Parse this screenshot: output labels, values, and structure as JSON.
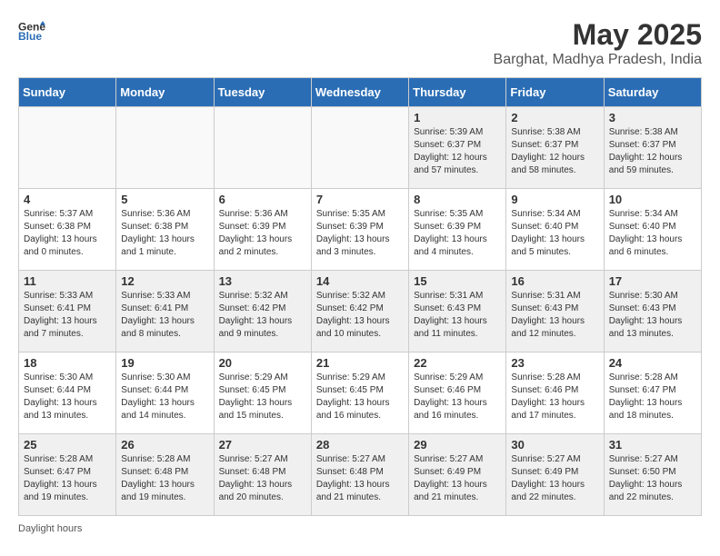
{
  "header": {
    "logo_general": "General",
    "logo_blue": "Blue",
    "month_title": "May 2025",
    "location": "Barghat, Madhya Pradesh, India"
  },
  "days_of_week": [
    "Sunday",
    "Monday",
    "Tuesday",
    "Wednesday",
    "Thursday",
    "Friday",
    "Saturday"
  ],
  "weeks": [
    [
      {
        "day": "",
        "empty": true
      },
      {
        "day": "",
        "empty": true
      },
      {
        "day": "",
        "empty": true
      },
      {
        "day": "",
        "empty": true
      },
      {
        "day": "1",
        "info": "Sunrise: 5:39 AM\nSunset: 6:37 PM\nDaylight: 12 hours\nand 57 minutes."
      },
      {
        "day": "2",
        "info": "Sunrise: 5:38 AM\nSunset: 6:37 PM\nDaylight: 12 hours\nand 58 minutes."
      },
      {
        "day": "3",
        "info": "Sunrise: 5:38 AM\nSunset: 6:37 PM\nDaylight: 12 hours\nand 59 minutes."
      }
    ],
    [
      {
        "day": "4",
        "info": "Sunrise: 5:37 AM\nSunset: 6:38 PM\nDaylight: 13 hours\nand 0 minutes."
      },
      {
        "day": "5",
        "info": "Sunrise: 5:36 AM\nSunset: 6:38 PM\nDaylight: 13 hours\nand 1 minute."
      },
      {
        "day": "6",
        "info": "Sunrise: 5:36 AM\nSunset: 6:39 PM\nDaylight: 13 hours\nand 2 minutes."
      },
      {
        "day": "7",
        "info": "Sunrise: 5:35 AM\nSunset: 6:39 PM\nDaylight: 13 hours\nand 3 minutes."
      },
      {
        "day": "8",
        "info": "Sunrise: 5:35 AM\nSunset: 6:39 PM\nDaylight: 13 hours\nand 4 minutes."
      },
      {
        "day": "9",
        "info": "Sunrise: 5:34 AM\nSunset: 6:40 PM\nDaylight: 13 hours\nand 5 minutes."
      },
      {
        "day": "10",
        "info": "Sunrise: 5:34 AM\nSunset: 6:40 PM\nDaylight: 13 hours\nand 6 minutes."
      }
    ],
    [
      {
        "day": "11",
        "info": "Sunrise: 5:33 AM\nSunset: 6:41 PM\nDaylight: 13 hours\nand 7 minutes."
      },
      {
        "day": "12",
        "info": "Sunrise: 5:33 AM\nSunset: 6:41 PM\nDaylight: 13 hours\nand 8 minutes."
      },
      {
        "day": "13",
        "info": "Sunrise: 5:32 AM\nSunset: 6:42 PM\nDaylight: 13 hours\nand 9 minutes."
      },
      {
        "day": "14",
        "info": "Sunrise: 5:32 AM\nSunset: 6:42 PM\nDaylight: 13 hours\nand 10 minutes."
      },
      {
        "day": "15",
        "info": "Sunrise: 5:31 AM\nSunset: 6:43 PM\nDaylight: 13 hours\nand 11 minutes."
      },
      {
        "day": "16",
        "info": "Sunrise: 5:31 AM\nSunset: 6:43 PM\nDaylight: 13 hours\nand 12 minutes."
      },
      {
        "day": "17",
        "info": "Sunrise: 5:30 AM\nSunset: 6:43 PM\nDaylight: 13 hours\nand 13 minutes."
      }
    ],
    [
      {
        "day": "18",
        "info": "Sunrise: 5:30 AM\nSunset: 6:44 PM\nDaylight: 13 hours\nand 13 minutes."
      },
      {
        "day": "19",
        "info": "Sunrise: 5:30 AM\nSunset: 6:44 PM\nDaylight: 13 hours\nand 14 minutes."
      },
      {
        "day": "20",
        "info": "Sunrise: 5:29 AM\nSunset: 6:45 PM\nDaylight: 13 hours\nand 15 minutes."
      },
      {
        "day": "21",
        "info": "Sunrise: 5:29 AM\nSunset: 6:45 PM\nDaylight: 13 hours\nand 16 minutes."
      },
      {
        "day": "22",
        "info": "Sunrise: 5:29 AM\nSunset: 6:46 PM\nDaylight: 13 hours\nand 16 minutes."
      },
      {
        "day": "23",
        "info": "Sunrise: 5:28 AM\nSunset: 6:46 PM\nDaylight: 13 hours\nand 17 minutes."
      },
      {
        "day": "24",
        "info": "Sunrise: 5:28 AM\nSunset: 6:47 PM\nDaylight: 13 hours\nand 18 minutes."
      }
    ],
    [
      {
        "day": "25",
        "info": "Sunrise: 5:28 AM\nSunset: 6:47 PM\nDaylight: 13 hours\nand 19 minutes."
      },
      {
        "day": "26",
        "info": "Sunrise: 5:28 AM\nSunset: 6:48 PM\nDaylight: 13 hours\nand 19 minutes."
      },
      {
        "day": "27",
        "info": "Sunrise: 5:27 AM\nSunset: 6:48 PM\nDaylight: 13 hours\nand 20 minutes."
      },
      {
        "day": "28",
        "info": "Sunrise: 5:27 AM\nSunset: 6:48 PM\nDaylight: 13 hours\nand 21 minutes."
      },
      {
        "day": "29",
        "info": "Sunrise: 5:27 AM\nSunset: 6:49 PM\nDaylight: 13 hours\nand 21 minutes."
      },
      {
        "day": "30",
        "info": "Sunrise: 5:27 AM\nSunset: 6:49 PM\nDaylight: 13 hours\nand 22 minutes."
      },
      {
        "day": "31",
        "info": "Sunrise: 5:27 AM\nSunset: 6:50 PM\nDaylight: 13 hours\nand 22 minutes."
      }
    ]
  ],
  "footer": {
    "daylight_label": "Daylight hours"
  }
}
